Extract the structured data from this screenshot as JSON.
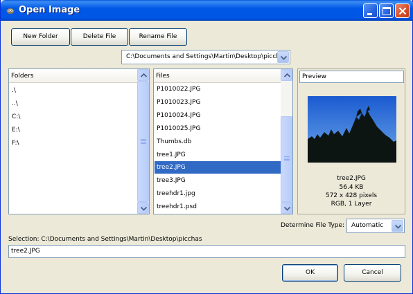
{
  "window": {
    "title": "Open Image",
    "app_icon": "gimp-icon",
    "controls": [
      "minimize-icon",
      "maximize-icon",
      "close-icon"
    ]
  },
  "toolbar": {
    "new_folder_label": "New Folder",
    "delete_file_label": "Delete File",
    "rename_file_label": "Rename File"
  },
  "path_combo": {
    "value": "C:\\Documents and Settings\\Martin\\Desktop\\picchas"
  },
  "folders": {
    "header": "Folders",
    "items": [
      ".\\",
      "..\\",
      "C:\\",
      "E:\\",
      "F:\\"
    ]
  },
  "files": {
    "header": "Files",
    "items": [
      "P1010022.JPG",
      "P1010023.JPG",
      "P1010024.JPG",
      "P1010025.JPG",
      "Thumbs.db",
      "tree1.JPG",
      "tree2.JPG",
      "tree3.JPG",
      "treehdr1.jpg",
      "treehdr1.psd"
    ],
    "selected_index": 6
  },
  "preview": {
    "header": "Preview",
    "filename": "tree2.JPG",
    "size": "56.4 KB",
    "dimensions": "572 x 428 pixels",
    "mode": "RGB, 1 Layer",
    "colors": {
      "sky_top": "#1a5ad0",
      "sky_bottom": "#6fa9ea",
      "trees": "#0d1512"
    }
  },
  "file_type": {
    "label": "Determine File Type:",
    "value": "Automatic"
  },
  "selection": {
    "label": "Selection: C:\\Documents and Settings\\Martin\\Desktop\\picchas",
    "value": "tree2.JPG"
  },
  "buttons": {
    "ok_label": "OK",
    "cancel_label": "Cancel"
  },
  "colors": {
    "title_bar": "#0058e6",
    "selection": "#316ac5",
    "dialog_bg": "#ece9d8"
  }
}
